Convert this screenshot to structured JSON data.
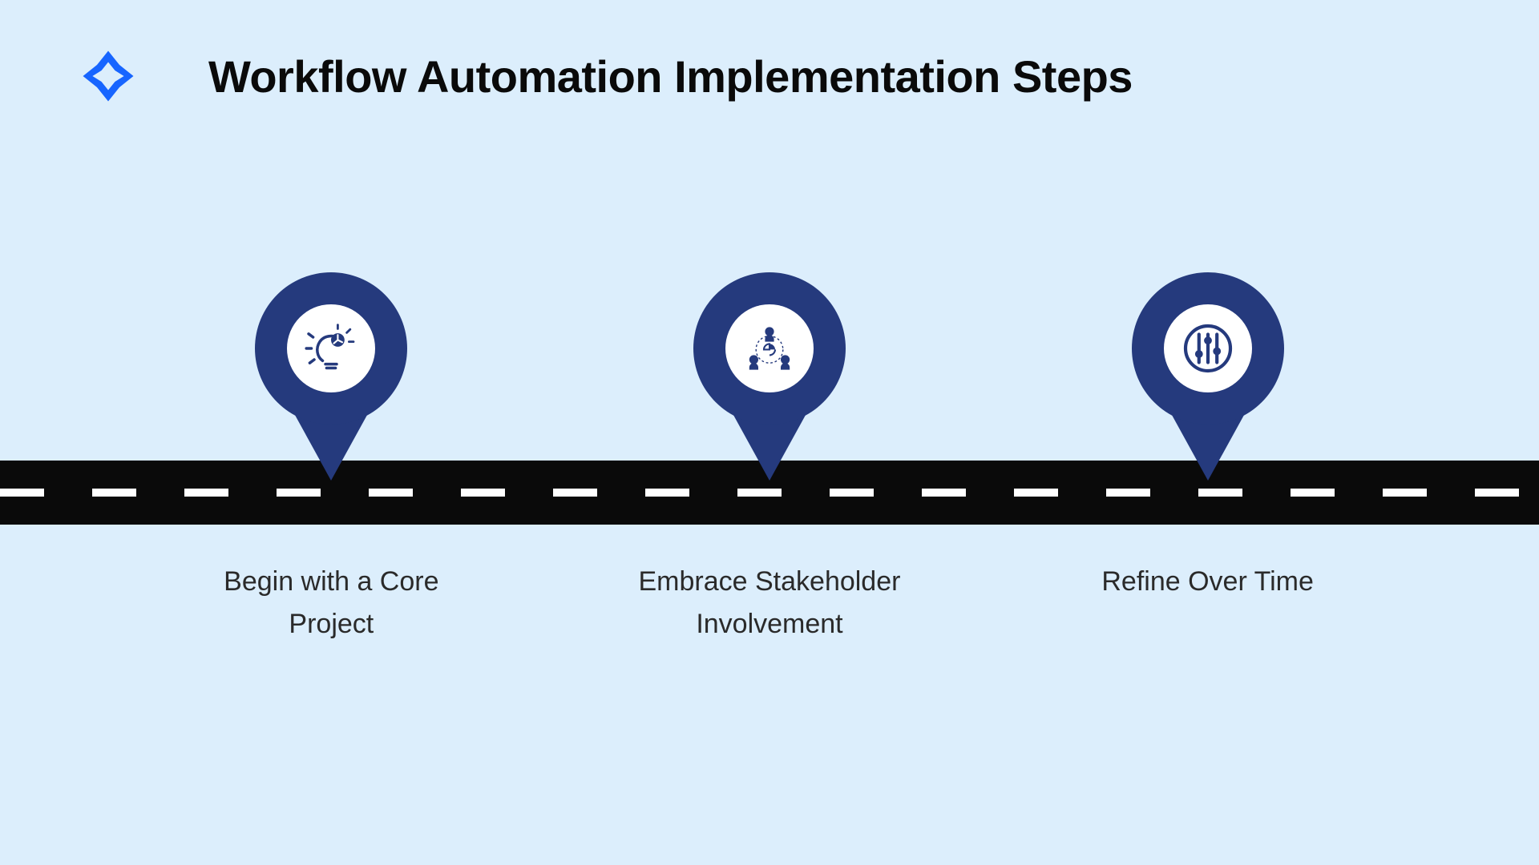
{
  "title": "Workflow Automation Implementation Steps",
  "steps": [
    {
      "label": "Begin with a Core Project",
      "icon": "idea-gear-icon"
    },
    {
      "label": "Embrace Stakeholder Involvement",
      "icon": "team-network-icon"
    },
    {
      "label": "Refine Over Time",
      "icon": "sliders-icon"
    }
  ],
  "colors": {
    "background": "#dceefc",
    "pin": "#253a7d",
    "road": "#0a0a0a",
    "logo": "#1765ff"
  }
}
